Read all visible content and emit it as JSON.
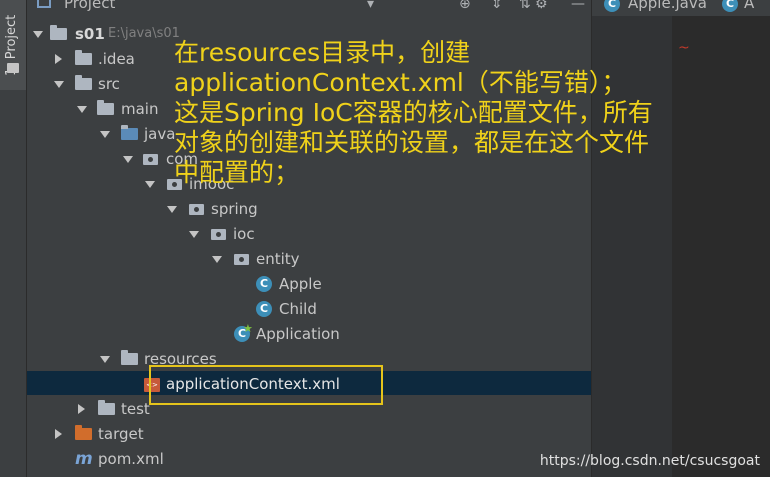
{
  "toolstrip": {
    "tab_label": "1: Project"
  },
  "panel": {
    "title": "Project"
  },
  "tree": {
    "root": {
      "name": "s01",
      "path": "E:\\java\\s01"
    },
    "idea": ".idea",
    "src": "src",
    "main": "main",
    "java": "java",
    "com": "com",
    "imooc": "imooc",
    "spring": "spring",
    "ioc": "ioc",
    "entity": "entity",
    "apple": "Apple",
    "child": "Child",
    "application": "Application",
    "resources": "resources",
    "app_context": "applicationContext.xml",
    "test": "test",
    "target": "target",
    "pom": "pom.xml"
  },
  "editor": {
    "tab1": "Apple.java",
    "tab2": "A"
  },
  "annotation": {
    "line1": "在resources目录中，创建",
    "line2": "applicationContext.xml（不能写错）；",
    "line3": "这是Spring IoC容器的核心配置文件，所有",
    "line4": "对象的创建和关联的设置，都是在这个文件",
    "line5": "中配置的；"
  },
  "watermark": "https://blog.csdn.net/csucsgoat",
  "colors": {
    "annotation": "#f0d21a",
    "highlight_box": "#e5c41b",
    "selection": "#0d293e",
    "panel": "#3c3f41"
  }
}
